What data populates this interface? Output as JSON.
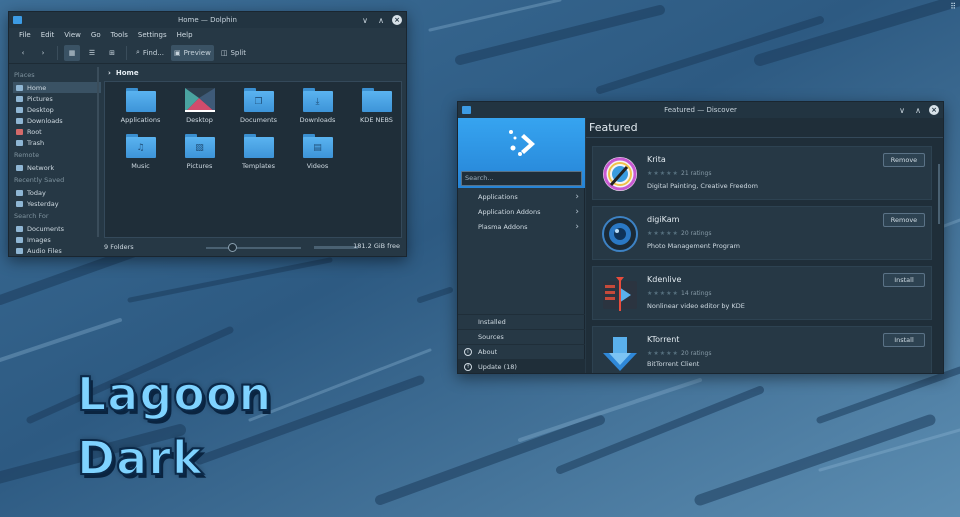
{
  "colors": {
    "accent": "#3daee9",
    "window_bg": "#263845",
    "view_bg": "#1f2e39",
    "folder": "#4aa3e6",
    "logo_text": "#7fd3ff"
  },
  "corner_label": "⠿",
  "dolphin": {
    "title": "Home — Dolphin",
    "menu": [
      "File",
      "Edit",
      "View",
      "Go",
      "Tools",
      "Settings",
      "Help"
    ],
    "toolbar": {
      "find": "Find...",
      "preview": "Preview",
      "split": "Split"
    },
    "breadcrumb": "Home",
    "places": {
      "places_header": "Places",
      "places_items": [
        "Home",
        "Pictures",
        "Desktop",
        "Downloads",
        "Root",
        "Trash"
      ],
      "remote_header": "Remote",
      "remote_items": [
        "Network"
      ],
      "recent_header": "Recently Saved",
      "recent_items": [
        "Today",
        "Yesterday"
      ],
      "search_header": "Search For",
      "search_items": [
        "Documents",
        "Images",
        "Audio Files"
      ]
    },
    "files": [
      "Applications",
      "Desktop",
      "Documents",
      "Downloads",
      "KDE NEBS",
      "Music",
      "Pictures",
      "Templates",
      "Videos"
    ],
    "status_count": "9 Folders",
    "status_free": "181.2 GiB free"
  },
  "discover": {
    "title": "Featured — Discover",
    "search_placeholder": "Search...",
    "categories": [
      "Applications",
      "Application Addons",
      "Plasma Addons"
    ],
    "bottom": [
      "Installed",
      "Sources",
      "About",
      "Update (18)"
    ],
    "featured_title": "Featured",
    "apps": [
      {
        "name": "Krita",
        "ratings": "21 ratings",
        "desc": "Digital Painting, Creative Freedom",
        "action": "Remove",
        "icon": "krita-icon"
      },
      {
        "name": "digiKam",
        "ratings": "20 ratings",
        "desc": "Photo Management Program",
        "action": "Remove",
        "icon": "digikam-icon"
      },
      {
        "name": "Kdenlive",
        "ratings": "14 ratings",
        "desc": "Nonlinear video editor by KDE",
        "action": "Install",
        "icon": "kdenlive-icon"
      },
      {
        "name": "KTorrent",
        "ratings": "20 ratings",
        "desc": "BitTorrent Client",
        "action": "Install",
        "icon": "ktorrent-icon"
      }
    ]
  },
  "logo_text": "Lagoon Dark"
}
